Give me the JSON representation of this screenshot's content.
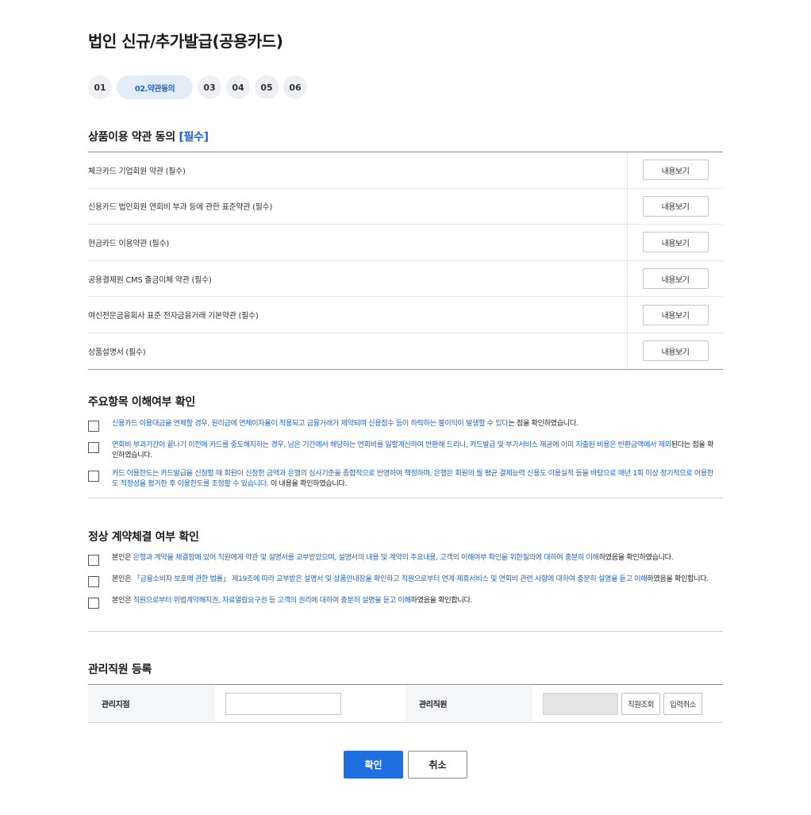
{
  "page": {
    "title": "법인 신규/추가발급(공용카드)"
  },
  "steps": [
    "01",
    "02.약관동의",
    "03",
    "04",
    "05",
    "06"
  ],
  "terms_section": {
    "title": "상품이용 약관 동의",
    "required_tag": "[필수]",
    "view_label": "내용보기",
    "items": [
      "체크카드 기업회원 약관 (필수)",
      "신용카드 법인회원 연회비 부과 등에 관한 표준약관 (필수)",
      "현금카드 이용약관 (필수)",
      "공용결제원 CMS 출금이체 약관 (필수)",
      "여신전문금융회사 표준 전자금융거래 기본약관 (필수)",
      "상품설명서 (필수)"
    ]
  },
  "understanding_section": {
    "title": "주요항목 이해여부 확인",
    "items": [
      {
        "blue": "신용카드 이용대금을 연체할 경우, 원리금에 연체이자율이 적용되고 금융거래가 제약되며 신용점수 등이 하락하는 불이익이 발생할 수 있다",
        "black": "는 점을 확인하였습니다."
      },
      {
        "blue": "연회비 부과기간이 끝나기 이전에 카드를 중도해지하는 경우, 남은 기간에서 해당하는 연회비를 일할계산하여 반환해 드리나, 카드발급 및 부가서비스 제공에 이미 지출된 비용은 반환금액에서 제외",
        "black": "된다는 점을 확인하였습니다."
      },
      {
        "blue": "카드 이용한도는 카드발급을 신청할 때 회원이 신청한 금액과 은행의 심사기준을 종합적으로 반영하여 책정하며, 은행은 회원의 월 평균 결제능력 신용도 이용실적 등을 바탕으로 매년 1회 이상 정기적으로 이용한도 적정성을 평가한 후 이용한도를 조정할 수 있습니다.",
        "black": " 이 내용을 확인하였습니다."
      }
    ]
  },
  "contract_section": {
    "title": "정상 계약체결 여부 확인",
    "items": [
      {
        "pre": "본인은 ",
        "blue": "은행과 계약을 체결함에 있어 직원에게 약관 및 설명서를 교부받았으며, 설명서의 내용 및 계약의 주요내용, 고객의 이해여부 확인을 위한질의에 대하여 충분히 이해",
        "post": "하였음을 확인하였습니다."
      },
      {
        "pre": "본인은 ",
        "blue": "「금융소비자 보호에 관한 법률」 제19조에 따라 교부받은 설명서 및 상품안내장을 확인하고 직원으로부터 연계·제휴서비스 및 연회비 관련 사항에 대하여 충분히 설명을 듣고 이해",
        "post": "하였음을 확인합니다."
      },
      {
        "pre": "본인은 ",
        "blue": "직원으로부터 위법계약해지권, 자료열람요구권 등 고객의 권리에 대하여 충분히 설명을 듣고 이해",
        "post": "하였음을 확인합니다."
      }
    ]
  },
  "staff_section": {
    "title": "관리직원 등록",
    "branch_label": "관리지점",
    "employee_label": "관리직원",
    "lookup_label": "직원조회",
    "reset_label": "입력취소"
  },
  "actions": {
    "confirm": "확인",
    "cancel": "취소"
  }
}
